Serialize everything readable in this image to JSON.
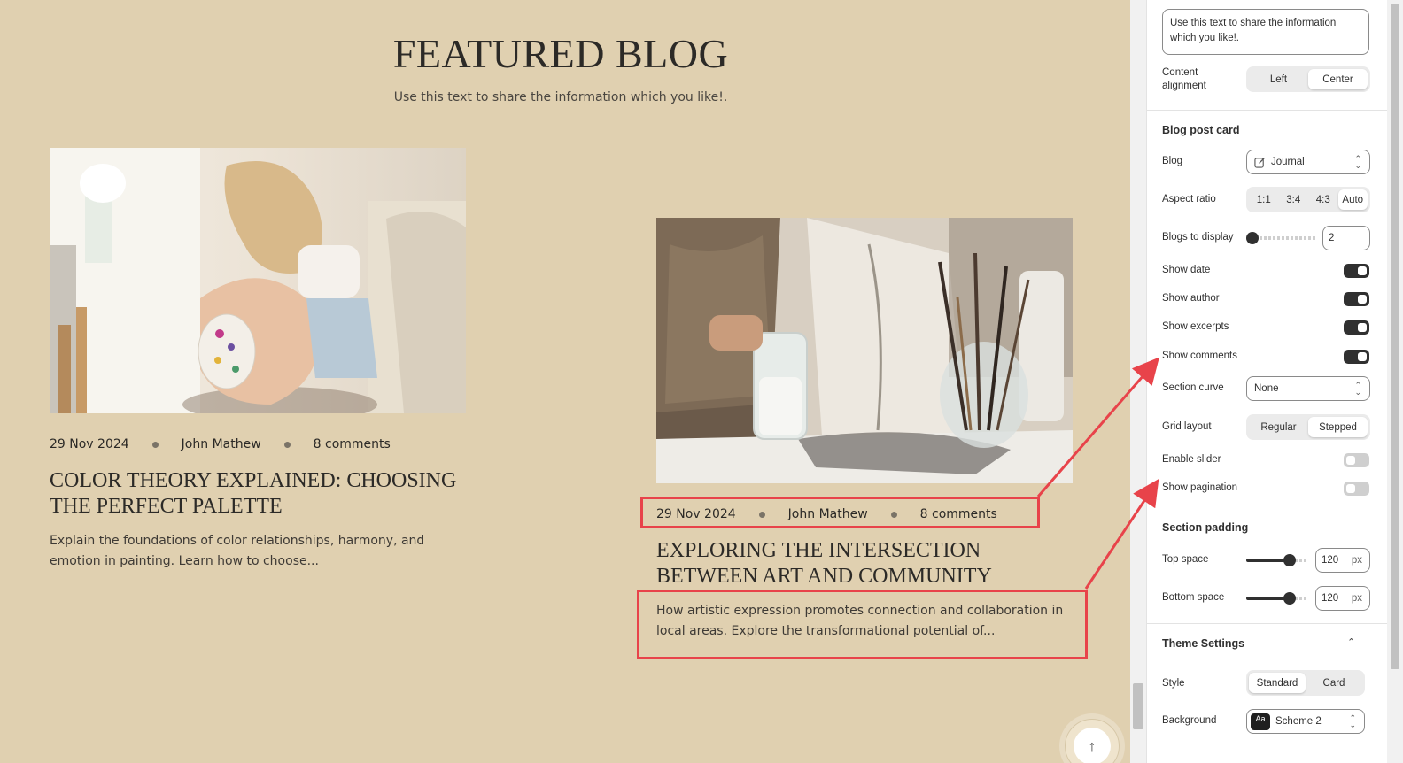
{
  "preview": {
    "section_title": "FEATURED BLOG",
    "section_subtitle": "Use this text to share the information which you like!.",
    "posts": [
      {
        "date": "29 Nov 2024",
        "author": "John Mathew",
        "comments": "8 comments",
        "title": "COLOR THEORY EXPLAINED: CHOOSING THE PERFECT PALETTE",
        "excerpt": "Explain the foundations of color relationships, harmony, and emotion in painting. Learn how to choose..."
      },
      {
        "date": "29 Nov 2024",
        "author": "John Mathew",
        "comments": "8 comments",
        "title": "EXPLORING THE INTERSECTION BETWEEN ART AND COMMUNITY",
        "excerpt": "How artistic expression promotes connection and collaboration in local areas. Explore the transformational potential of..."
      }
    ],
    "annotation_color": "#e8434a"
  },
  "panel": {
    "text_value": "Use this text to share the information which you like!.",
    "content_alignment": {
      "label": "Content alignment",
      "options": [
        "Left",
        "Center"
      ],
      "selected": "Center"
    },
    "blog_post_card": {
      "heading": "Blog post card",
      "blog": {
        "label": "Blog",
        "value": "Journal"
      },
      "aspect_ratio": {
        "label": "Aspect ratio",
        "options": [
          "1:1",
          "3:4",
          "4:3",
          "Auto"
        ],
        "selected": "Auto"
      },
      "blogs_to_display": {
        "label": "Blogs to display",
        "value": "2"
      },
      "show_date": {
        "label": "Show date",
        "on": true
      },
      "show_author": {
        "label": "Show author",
        "on": true
      },
      "show_excerpts": {
        "label": "Show excerpts",
        "on": true
      },
      "show_comments": {
        "label": "Show comments",
        "on": true
      },
      "section_curve": {
        "label": "Section curve",
        "value": "None"
      },
      "grid_layout": {
        "label": "Grid layout",
        "options": [
          "Regular",
          "Stepped"
        ],
        "selected": "Stepped"
      },
      "enable_slider": {
        "label": "Enable slider",
        "on": false
      },
      "show_pagination": {
        "label": "Show pagination",
        "on": false
      }
    },
    "section_padding": {
      "heading": "Section padding",
      "top_space": {
        "label": "Top space",
        "value": "120",
        "unit": "px"
      },
      "bottom_space": {
        "label": "Bottom space",
        "value": "120",
        "unit": "px"
      }
    },
    "theme_settings": {
      "heading": "Theme Settings",
      "style": {
        "label": "Style",
        "options": [
          "Standard",
          "Card"
        ],
        "selected": "Standard"
      },
      "background": {
        "label": "Background",
        "value": "Scheme 2",
        "swatch_text": "Aa"
      }
    }
  }
}
